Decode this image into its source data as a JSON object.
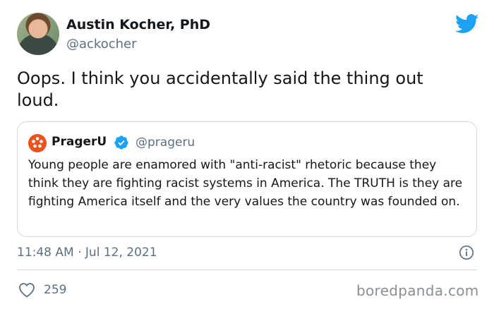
{
  "author": {
    "name": "Austin Kocher, PhD",
    "handle": "@ackocher"
  },
  "tweet": {
    "text": "Oops. I think you accidentally said the thing out loud."
  },
  "quoted_tweet": {
    "name": "PragerU",
    "handle": "@prageru",
    "text": "Young people are enamored with \"anti-racist\" rhetoric because they think they are fighting racist systems in America. The TRUTH is they are fighting America itself and the very values the country was founded on."
  },
  "meta": {
    "timestamp": "11:48 AM · Jul 12, 2021",
    "likes": "259"
  },
  "watermark": "boredpanda.com",
  "colors": {
    "twitter_blue": "#1da1f2",
    "prageru_orange": "#e8541c",
    "muted_text": "#5b7083"
  },
  "icons": {
    "logo": "twitter-bird-icon",
    "verified": "verified-badge-icon",
    "info": "info-icon",
    "like": "heart-icon"
  }
}
